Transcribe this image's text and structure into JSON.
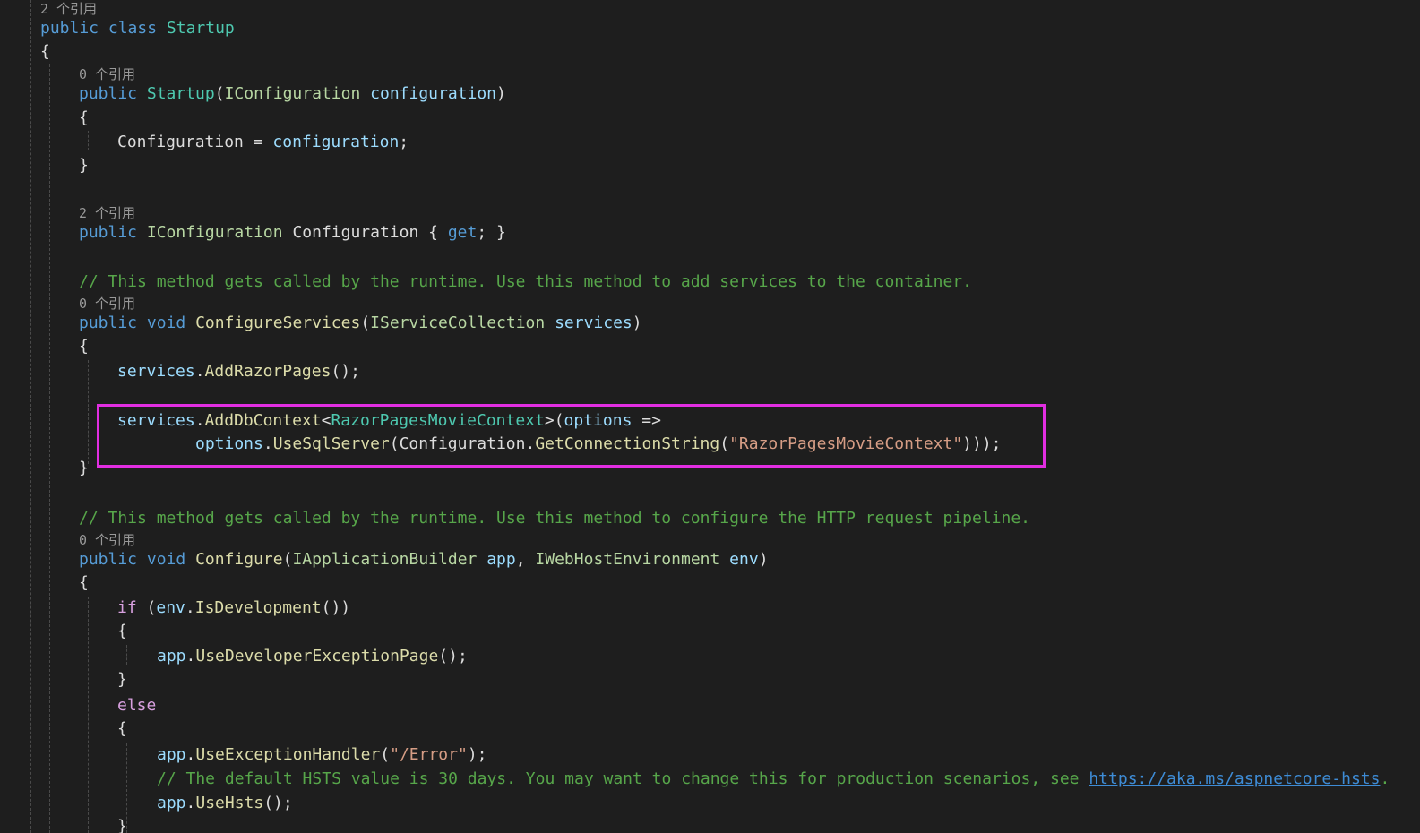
{
  "editor": {
    "colors": {
      "background": "#1e1e1e",
      "keyword": "#569cd6",
      "type": "#4ec9b0",
      "method": "#dcdcaa",
      "parameter": "#9cdcfe",
      "string": "#d69d85",
      "comment": "#57a64a",
      "highlight_box": "#e22ee2"
    },
    "lens": {
      "class_refs": "2 个引用",
      "ctor_refs": "0 个引用",
      "config_refs": "2 个引用",
      "configure_services_refs": "0 个引用",
      "configure_refs": "0 个引用"
    },
    "code": {
      "public": "public",
      "class": "class",
      "void": "void",
      "get": "get",
      "if": "if",
      "else": "else",
      "startup": "Startup",
      "iconfiguration": "IConfiguration",
      "configuration_param": "configuration",
      "configuration_prop": "Configuration",
      "open_brace": "{",
      "close_brace": "}",
      "assign": " = ",
      "semicolon": ";",
      "open_paren": "(",
      "close_paren": ")",
      "prop_accessor": " { ",
      "prop_end": "; }",
      "comment_configure_services": "// This method gets called by the runtime. Use this method to add services to the container.",
      "configure_services": "ConfigureServices",
      "iservicecollection": "IServiceCollection",
      "services": "services",
      "dot": ".",
      "add_razor_pages": "AddRazorPages",
      "call_end": "();",
      "add_db_context": "AddDbContext",
      "lt": "<",
      "gt": ">",
      "razor_pages_movie_context_type": "RazorPagesMovieContext",
      "options": "options",
      "lambda": " =>",
      "use_sql_server": "UseSqlServer",
      "get_connection_string": "GetConnectionString",
      "connection_string_literal": "\"RazorPagesMovieContext\"",
      "close_parens_end": ")));",
      "comment_configure": "// This method gets called by the runtime. Use this method to configure the HTTP request pipeline.",
      "configure": "Configure",
      "iapplicationbuilder": "IApplicationBuilder",
      "app": "app",
      "comma": ", ",
      "iwebhostenvironment": "IWebHostEnvironment",
      "env": "env",
      "is_development": "IsDevelopment",
      "if_end": "())",
      "use_developer_exception_page": "UseDeveloperExceptionPage",
      "use_exception_handler": "UseExceptionHandler",
      "error_route": "\"/Error\"",
      "paren_semicolon": ");",
      "comment_hsts": "// The default HSTS value is 30 days. You may want to change this for production scenarios, see ",
      "hsts_link": "https://aka.ms/aspnetcore-hsts",
      "period": ".",
      "use_hsts": "UseHsts"
    }
  }
}
